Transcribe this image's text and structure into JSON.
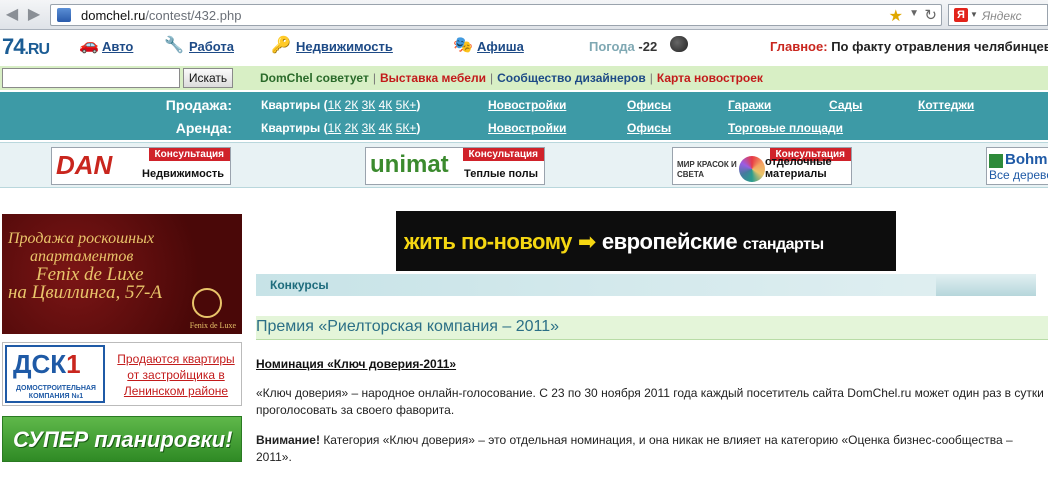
{
  "browser": {
    "url_host": "domchel.ru",
    "url_path": "/contest/432.php",
    "search_placeholder": "Яндекс",
    "search_engine_icon": "Я"
  },
  "topnav": {
    "logo_num": "74",
    "logo_ru": ".RU",
    "items": [
      "Авто",
      "Работа",
      "Недвижимость",
      "Афиша"
    ],
    "weather_label": "Погода",
    "weather_temp": "-22",
    "headline_label": "Главное:",
    "headline_text": "По факту отравления челябинцев"
  },
  "search": {
    "button": "Искать"
  },
  "promo_links": [
    "DomChel советует",
    "Выставка мебели",
    "Сообщество дизайнеров",
    "Карта новостроек"
  ],
  "realty": {
    "sale_label": "Продажа:",
    "rent_label": "Аренда:",
    "apts": "Квартиры",
    "rooms": [
      "1К",
      "2К",
      "3К",
      "4К",
      "5К+"
    ],
    "sale_items": [
      "Новостройки",
      "Офисы",
      "Гаражи",
      "Сады",
      "Коттеджи"
    ],
    "rent_items": [
      "Новостройки",
      "Офисы",
      "Торговые площади"
    ]
  },
  "banners": {
    "tag": "Консультация",
    "dan_mark": "DAN",
    "dan_caption": "Недвижимость",
    "unimat_mark": "unimat",
    "unimat_caption": "Теплые полы",
    "mir_mark": "МИР КРАСОК И СВЕТА",
    "mir_caption": "отделочные материалы",
    "bohm_mark": "Bohm",
    "bohm_caption": "Все деревo"
  },
  "ads": {
    "fenix_line1": "Продажа роскошных",
    "fenix_line2": "апартаментов",
    "fenix_line3": "Fenix de Luxe",
    "fenix_line4": "на Цвиллинга, 57-А",
    "fenix_small": "Fenix de Luxe",
    "dsk_logo": "ДСК",
    "dsk_num": "1",
    "dsk_sub": "ДОМОСТРОИТЕЛЬНАЯ КОМПАНИЯ №1",
    "dsk_text": "Продаются квартиры от застройщика в Ленинском районе",
    "super_text": "СУПЕР планировки!",
    "main_part1": "жить по-новому",
    "main_part2": "европейские",
    "main_part3": "стандарты"
  },
  "content": {
    "crumb": "Конкурсы",
    "title": "Премия «Риелторская компания – 2011»",
    "nomination": "Номинация «Ключ доверия-2011»",
    "para1": "«Ключ доверия» – народное онлайн-голосование. С 23 по 30 ноября 2011 года каждый посетитель сайта DomChel.ru может один раз в сутки проголосовать за своего фаворита.",
    "attention": "Внимание!",
    "para2": " Категория «Ключ доверия» – это отдельная номинация, и она никак не влияет на категорию «Оценка бизнес-сообщества – 2011»."
  }
}
